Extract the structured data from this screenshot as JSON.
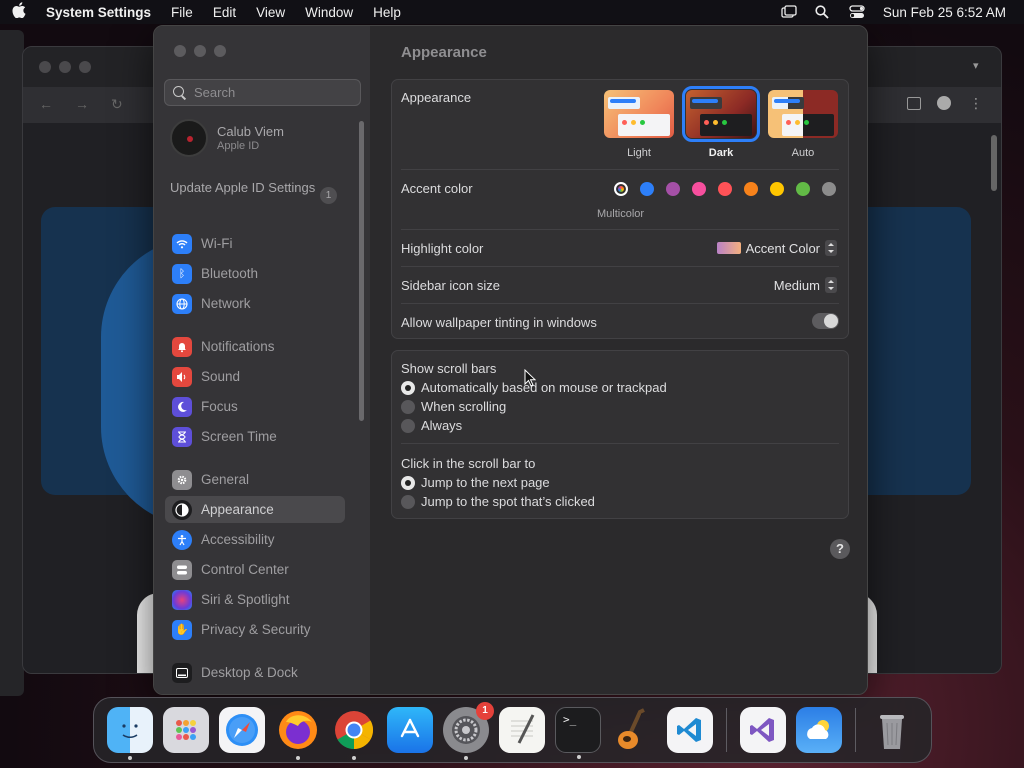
{
  "menubar": {
    "app_name": "System Settings",
    "menus": [
      "File",
      "Edit",
      "View",
      "Window",
      "Help"
    ],
    "datetime": "Sun Feb 25  6:52 AM"
  },
  "window": {
    "title": "Appearance",
    "search_placeholder": "Search"
  },
  "sidebar": {
    "profile": {
      "name": "Calub Viem",
      "subtitle": "Apple ID"
    },
    "update_notice": "Update Apple ID Settings",
    "update_count": "1",
    "items": [
      {
        "label": "Wi-Fi",
        "icon": "wifi-icon",
        "color": "#2d7ff9"
      },
      {
        "label": "Bluetooth",
        "icon": "bluetooth-icon",
        "color": "#2d7ff9"
      },
      {
        "label": "Network",
        "icon": "globe-icon",
        "color": "#2d7ff9"
      },
      {
        "label": "Notifications",
        "icon": "bell-icon",
        "color": "#e4483e"
      },
      {
        "label": "Sound",
        "icon": "speaker-icon",
        "color": "#e4483e"
      },
      {
        "label": "Focus",
        "icon": "moon-icon",
        "color": "#5e4fd9"
      },
      {
        "label": "Screen Time",
        "icon": "hourglass-icon",
        "color": "#5e4fd9"
      },
      {
        "label": "General",
        "icon": "gear-icon",
        "color": "#8e8d90"
      },
      {
        "label": "Appearance",
        "icon": "appearance-icon",
        "color": "#1d1d1f"
      },
      {
        "label": "Accessibility",
        "icon": "accessibility-icon",
        "color": "#2d7ff9"
      },
      {
        "label": "Control Center",
        "icon": "control-center-icon",
        "color": "#8e8d90"
      },
      {
        "label": "Siri & Spotlight",
        "icon": "siri-icon",
        "color": "#b44ad1"
      },
      {
        "label": "Privacy & Security",
        "icon": "hand-icon",
        "color": "#2d7ff9"
      },
      {
        "label": "Desktop & Dock",
        "icon": "dock-icon",
        "color": "#1d1d1f"
      }
    ],
    "selected": "Appearance"
  },
  "appearance": {
    "label": "Appearance",
    "options": [
      {
        "label": "Light",
        "selected": false
      },
      {
        "label": "Dark",
        "selected": true
      },
      {
        "label": "Auto",
        "selected": false
      }
    ],
    "accent_label": "Accent color",
    "accent_colors": [
      "multicolor",
      "#2d7ff9",
      "#a550a7",
      "#f74f9e",
      "#ff5257",
      "#f7821b",
      "#ffc600",
      "#62ba46",
      "#8c8c8c"
    ],
    "accent_selected_label": "Multicolor",
    "highlight_label": "Highlight color",
    "highlight_value": "Accent Color",
    "sidebar_icon_label": "Sidebar icon size",
    "sidebar_icon_value": "Medium",
    "wallpaper_tint_label": "Allow wallpaper tinting in windows",
    "wallpaper_tint_on": false
  },
  "scroll": {
    "show_label": "Show scroll bars",
    "show_options": [
      "Automatically based on mouse or trackpad",
      "When scrolling",
      "Always"
    ],
    "show_selected": 0,
    "click_label": "Click in the scroll bar to",
    "click_options": [
      "Jump to the next page",
      "Jump to the spot that’s clicked"
    ],
    "click_selected": 0
  },
  "help_label": "?",
  "dock": {
    "apps": [
      "Finder",
      "Launchpad",
      "Safari",
      "Firefox",
      "Chrome",
      "App Store",
      "System Settings",
      "TextEdit",
      "Terminal",
      "GarageBand",
      "Visual Studio Code",
      "Visual Studio",
      "Weather",
      "Trash"
    ],
    "settings_badge": "1"
  }
}
